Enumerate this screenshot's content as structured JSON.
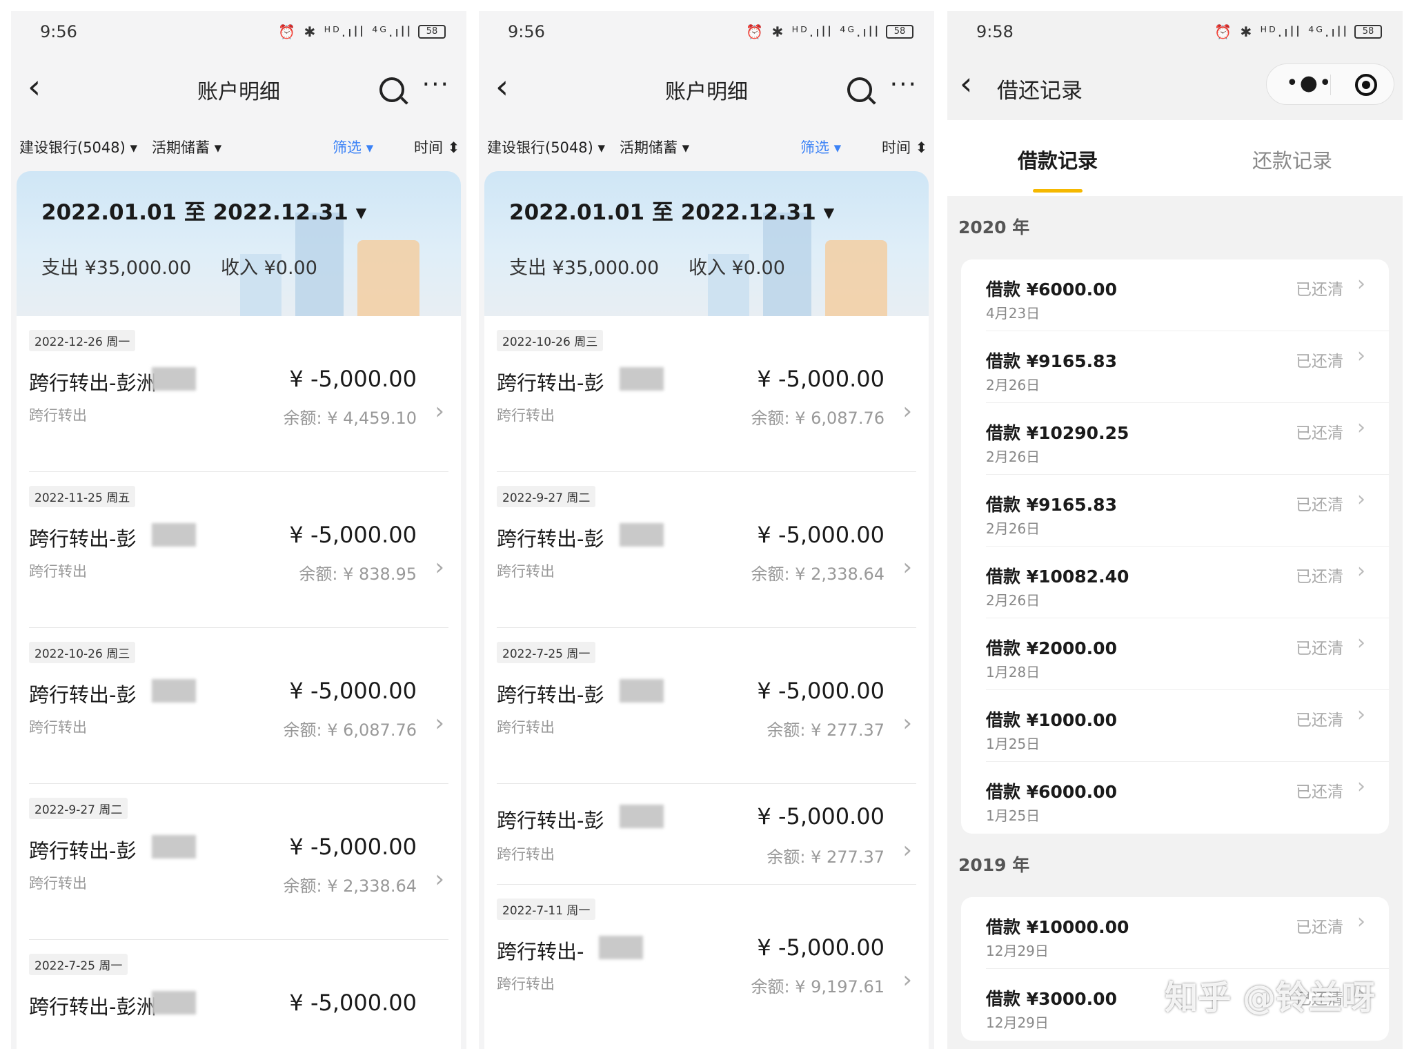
{
  "panels": [
    {
      "status": {
        "time": "9:56",
        "icons": "⏰ ✱ ᴴᴰ.ıll ⁴ᴳ.ıll",
        "battery": "58"
      },
      "nav": {
        "back": "‹",
        "title": "账户明细",
        "more": "···"
      },
      "filters": {
        "bank": "建设银行(5048) ▾",
        "type": "活期储蓄 ▾",
        "screen": "筛选 ▾",
        "time": "时间 ⬍"
      },
      "summary": {
        "range": "2022.01.01 至 2022.12.31 ▾",
        "spend": "支出 ¥35,000.00",
        "income": "收入 ¥0.00"
      },
      "transactions": [
        {
          "date": "2022-12-26 周一",
          "name": "跨行转出-彭洲",
          "sub": "跨行转出",
          "amount": "¥ -5,000.00",
          "balance": "余额: ¥ 4,459.10"
        },
        {
          "date": "2022-11-25 周五",
          "name": "跨行转出-彭",
          "sub": "跨行转出",
          "amount": "¥ -5,000.00",
          "balance": "余额: ¥ 838.95"
        },
        {
          "date": "2022-10-26 周三",
          "name": "跨行转出-彭",
          "sub": "跨行转出",
          "amount": "¥ -5,000.00",
          "balance": "余额: ¥ 6,087.76"
        },
        {
          "date": "2022-9-27 周二",
          "name": "跨行转出-彭",
          "sub": "跨行转出",
          "amount": "¥ -5,000.00",
          "balance": "余额: ¥ 2,338.64"
        },
        {
          "date": "2022-7-25 周一",
          "name": "跨行转出-彭洲",
          "sub": "",
          "amount": "¥ -5,000.00",
          "balance": ""
        }
      ]
    },
    {
      "status": {
        "time": "9:56",
        "icons": "⏰ ✱ ᴴᴰ.ıll ⁴ᴳ.ıll",
        "battery": "58"
      },
      "nav": {
        "back": "‹",
        "title": "账户明细",
        "more": "···"
      },
      "filters": {
        "bank": "建设银行(5048) ▾",
        "type": "活期储蓄 ▾",
        "screen": "筛选 ▾",
        "time": "时间 ⬍"
      },
      "summary": {
        "range": "2022.01.01 至 2022.12.31 ▾",
        "spend": "支出 ¥35,000.00",
        "income": "收入 ¥0.00"
      },
      "transactions": [
        {
          "date": "2022-10-26 周三",
          "name": "跨行转出-彭",
          "sub": "跨行转出",
          "amount": "¥ -5,000.00",
          "balance": "余额: ¥ 6,087.76"
        },
        {
          "date": "2022-9-27 周二",
          "name": "跨行转出-彭",
          "sub": "跨行转出",
          "amount": "¥ -5,000.00",
          "balance": "余额: ¥ 2,338.64"
        },
        {
          "date": "2022-7-25 周一",
          "name": "跨行转出-彭",
          "sub": "跨行转出",
          "amount": "¥ -5,000.00",
          "balance": "余额: ¥ 277.37"
        },
        {
          "date": "",
          "name": "跨行转出-彭",
          "sub": "跨行转出",
          "amount": "¥ -5,000.00",
          "balance": "余额: ¥ 277.37"
        },
        {
          "date": "2022-7-11 周一",
          "name": "跨行转出-",
          "sub": "跨行转出",
          "amount": "¥ -5,000.00",
          "balance": "余额: ¥ 9,197.61"
        }
      ]
    }
  ],
  "loan_page": {
    "status": {
      "time": "9:58",
      "icons": "⏰ ✱ ᴴᴰ.ıll ⁴ᴳ.ıll",
      "battery": "58"
    },
    "nav": {
      "back": "‹",
      "title": "借还记录",
      "dots": "•●•"
    },
    "tabs": {
      "borrow": "借款记录",
      "repay": "还款记录"
    },
    "groups": [
      {
        "year": "2020 年",
        "items": [
          {
            "amount": "借款 ¥6000.00",
            "date": "4月23日",
            "status": "已还清"
          },
          {
            "amount": "借款 ¥9165.83",
            "date": "2月26日",
            "status": "已还清"
          },
          {
            "amount": "借款 ¥10290.25",
            "date": "2月26日",
            "status": "已还清"
          },
          {
            "amount": "借款 ¥9165.83",
            "date": "2月26日",
            "status": "已还清"
          },
          {
            "amount": "借款 ¥10082.40",
            "date": "2月26日",
            "status": "已还清"
          },
          {
            "amount": "借款 ¥2000.00",
            "date": "1月28日",
            "status": "已还清"
          },
          {
            "amount": "借款 ¥1000.00",
            "date": "1月25日",
            "status": "已还清"
          },
          {
            "amount": "借款 ¥6000.00",
            "date": "1月25日",
            "status": "已还清"
          }
        ]
      },
      {
        "year": "2019 年",
        "items": [
          {
            "amount": "借款 ¥10000.00",
            "date": "12月29日",
            "status": "已还清"
          },
          {
            "amount": "借款 ¥3000.00",
            "date": "12月29日",
            "status": "已还清"
          }
        ]
      }
    ]
  },
  "watermark": "知乎 @铃兰呀",
  "colors": {
    "accent_yellow": "#f5b800",
    "filter_blue": "#3b82f6"
  }
}
